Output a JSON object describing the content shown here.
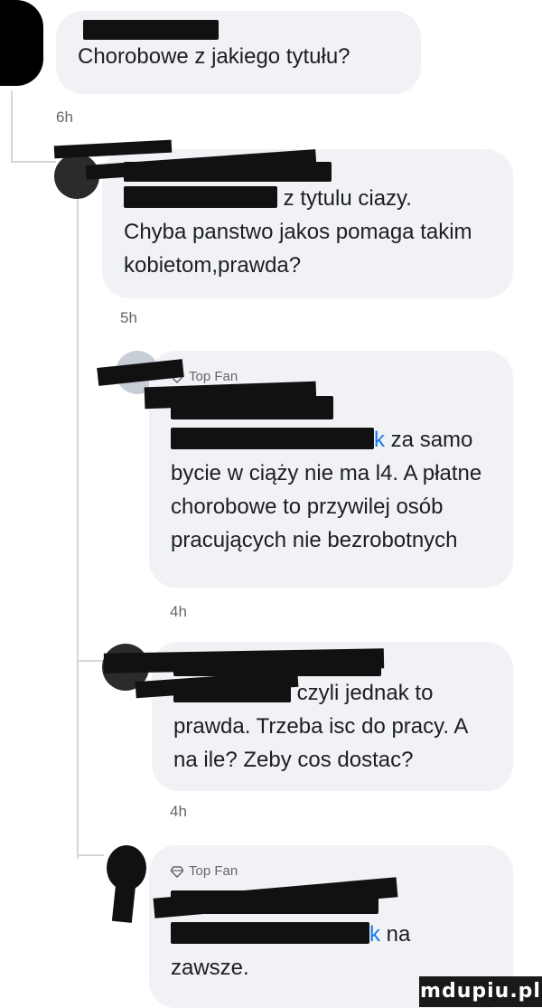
{
  "comments": [
    {
      "text": "Chorobowe z jakiego tytułu?",
      "time": "6h"
    },
    {
      "text_line1": "z tytulu ciazy.",
      "text_rest": "Chyba panstwo jakos pomaga takim kobietom,prawda?",
      "time": "5h"
    },
    {
      "badge": "Top Fan",
      "mention_tail": "k",
      "text_line1": "za samo",
      "text_rest": "bycie w ciąży nie ma l4. A płatne chorobowe to przywilej osób pracujących nie bezrobotnych",
      "time": "4h"
    },
    {
      "text_line1": "czyli jednak to",
      "text_rest": "prawda. Trzeba isc do pracy. A na ile? Zeby cos dostac?",
      "time": "4h"
    },
    {
      "badge": "Top Fan",
      "mention_tail": "k",
      "text_line1": "na",
      "text_rest": "zawsze."
    }
  ],
  "watermark": "mdupiu.pl",
  "colors": {
    "bubble": "#f0f2f5",
    "mention": "#1877f2",
    "meta": "#65676b"
  }
}
